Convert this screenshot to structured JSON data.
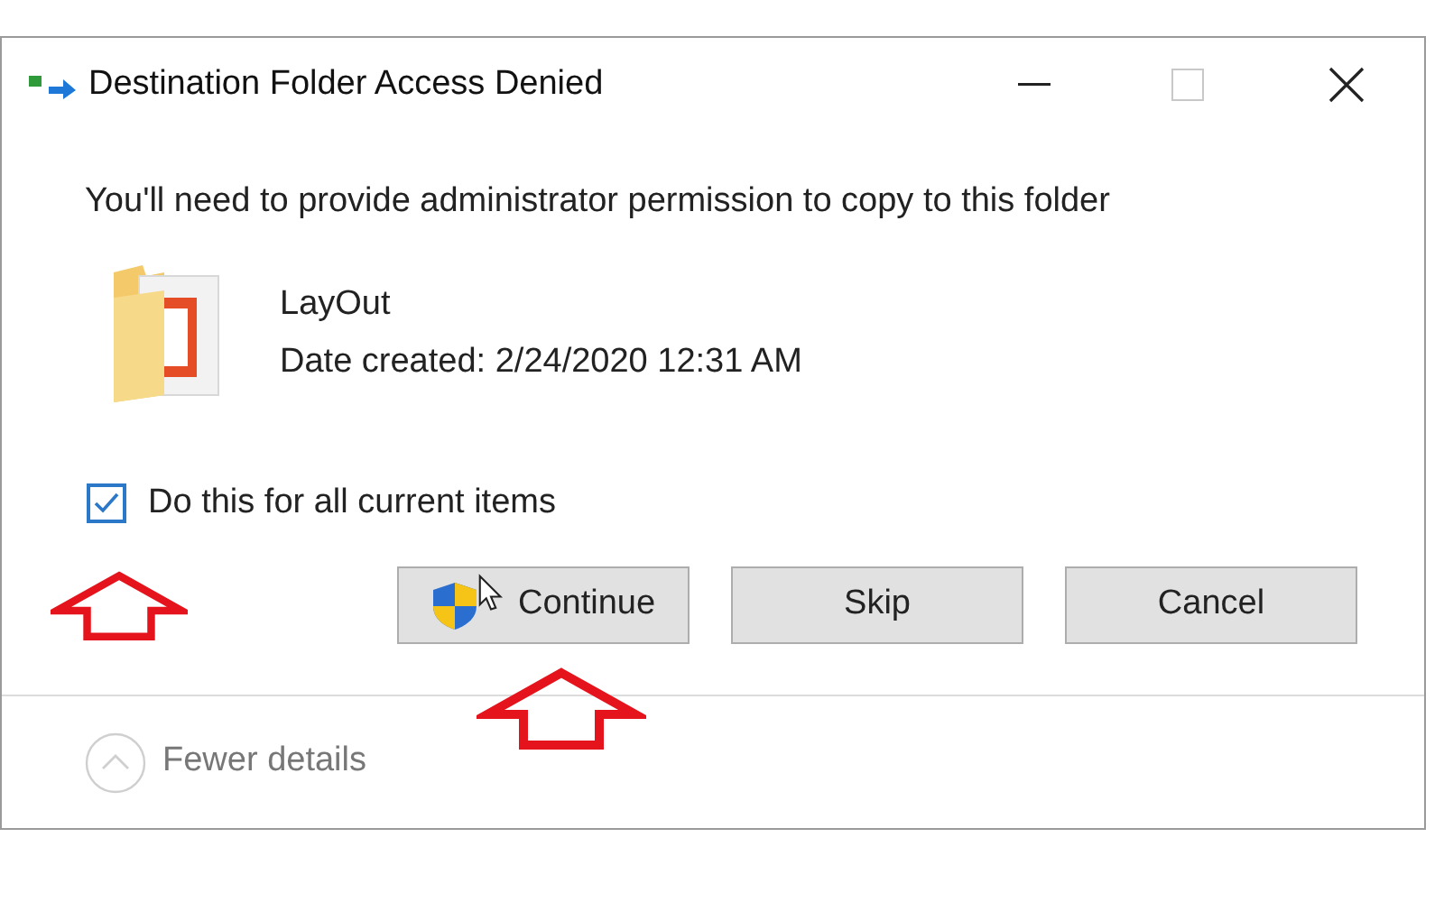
{
  "window": {
    "title": "Destination Folder Access Denied"
  },
  "message": "You'll need to provide administrator permission to copy to this folder",
  "item": {
    "name": "LayOut",
    "date": "Date created: 2/24/2020 12:31 AM"
  },
  "checkbox": {
    "label": "Do this for all current items",
    "checked": true
  },
  "buttons": [
    {
      "label": "Continue",
      "kind": "shield"
    },
    {
      "label": "Skip",
      "kind": "plain"
    },
    {
      "label": "Cancel",
      "kind": "plain"
    }
  ],
  "details": {
    "label": "Fewer details",
    "expanded": true
  }
}
